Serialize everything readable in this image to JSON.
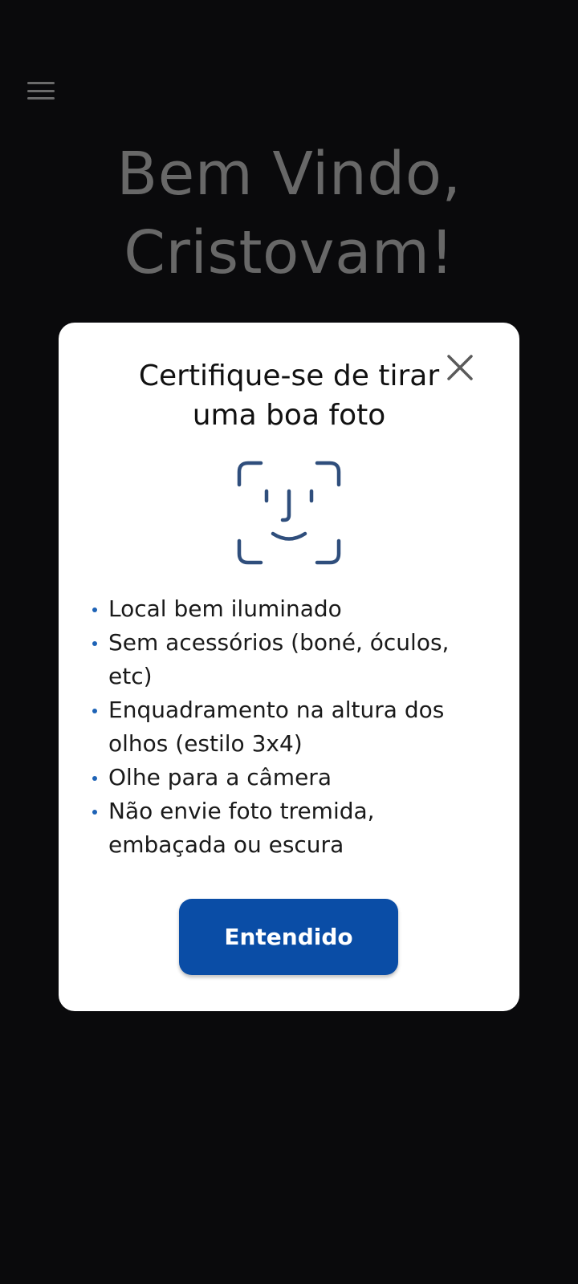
{
  "header": {
    "menu_icon": "hamburger-menu-icon",
    "welcome_line1": "Bem Vindo,",
    "welcome_line2": "Cristovam!"
  },
  "modal": {
    "title_line1": "Certifique-se de tirar",
    "title_line2": "uma boa foto",
    "close_icon": "close-icon",
    "illustration_icon": "face-id-icon",
    "tips": [
      "Local bem iluminado",
      "Sem acessórios (boné, óculos, etc)",
      "Enquadramento na altura dos olhos (estilo 3x4)",
      "Olhe para a câmera",
      "Não envie foto tremida, embaçada ou escura"
    ],
    "confirm_label": "Entendido"
  },
  "colors": {
    "background": "#0a0a0c",
    "welcome_text": "#686868",
    "modal_bg": "#ffffff",
    "primary_button": "#0a4da6",
    "bullet": "#1e63b6",
    "face_icon": "#2f4e7c"
  }
}
